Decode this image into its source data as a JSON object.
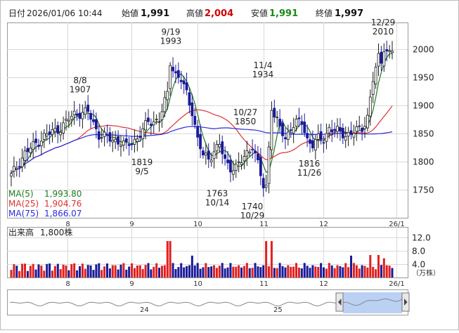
{
  "header": {
    "date_label": "日付",
    "datetime": "2026/01/06 10:44",
    "open_label": "始値",
    "open": "1,991",
    "high_label": "高値",
    "high": "2,004",
    "low_label": "安値",
    "low": "1,991",
    "close_label": "終値",
    "close": "1,997"
  },
  "colors": {
    "up": "#1a1a1a",
    "down": "#1a1a99",
    "ma5": "#1e7a1e",
    "ma25": "#e03030",
    "ma75": "#2a2ae0",
    "high_value": "#d00000",
    "low_value": "#1a8a1a",
    "volume": "#e02020",
    "volume_alt": "#1a1a99",
    "navigator_fill": "#a9c6f0"
  },
  "legend": [
    {
      "label": "MA(5)",
      "value": "1,993.80",
      "color": "#1e7a1e"
    },
    {
      "label": "MA(25)",
      "value": "1,904.76",
      "color": "#e03030"
    },
    {
      "label": "MA(75)",
      "value": "1,866.07",
      "color": "#2a2ae0"
    }
  ],
  "volume_panel": {
    "title": "出来高",
    "value": "1,800株",
    "unit": "（万株）"
  },
  "navigator": {
    "labels": [
      "24",
      "25"
    ]
  },
  "chart_data": [
    {
      "type": "candlestick",
      "title": "",
      "yticks": [
        1750,
        1800,
        1850,
        1900,
        1950,
        2000
      ],
      "ylim": [
        1700,
        2040
      ],
      "xticks": [
        "8",
        "9",
        "10",
        "11",
        "12",
        "26/1"
      ],
      "grid": true,
      "series": [
        {
          "name": "MA(5)",
          "last": 1993.8
        },
        {
          "name": "MA(25)",
          "last": 1904.76
        },
        {
          "name": "MA(75)",
          "last": 1866.07
        }
      ],
      "annotations": [
        {
          "date": "8/8",
          "value": 1907,
          "position": "above"
        },
        {
          "date": "9/19",
          "value": 1993,
          "position": "above"
        },
        {
          "date": "9/5",
          "value": 1819,
          "position": "below"
        },
        {
          "date": "10/14",
          "value": 1763,
          "position": "below"
        },
        {
          "date": "10/29",
          "value": 1740,
          "position": "below"
        },
        {
          "date": "10/27",
          "value": 1850,
          "position": "above"
        },
        {
          "date": "11/4",
          "value": 1934,
          "position": "above"
        },
        {
          "date": "11/26",
          "value": 1816,
          "position": "below"
        },
        {
          "date": "12/29",
          "value": 2010,
          "position": "above"
        }
      ]
    },
    {
      "type": "bar",
      "title": "出来高",
      "yticks": [
        4.0,
        8.0,
        12.0
      ],
      "ylim": [
        0,
        14
      ],
      "unit": "万株",
      "xticks": [
        "8",
        "9",
        "10",
        "11",
        "12",
        "26/1"
      ]
    }
  ]
}
